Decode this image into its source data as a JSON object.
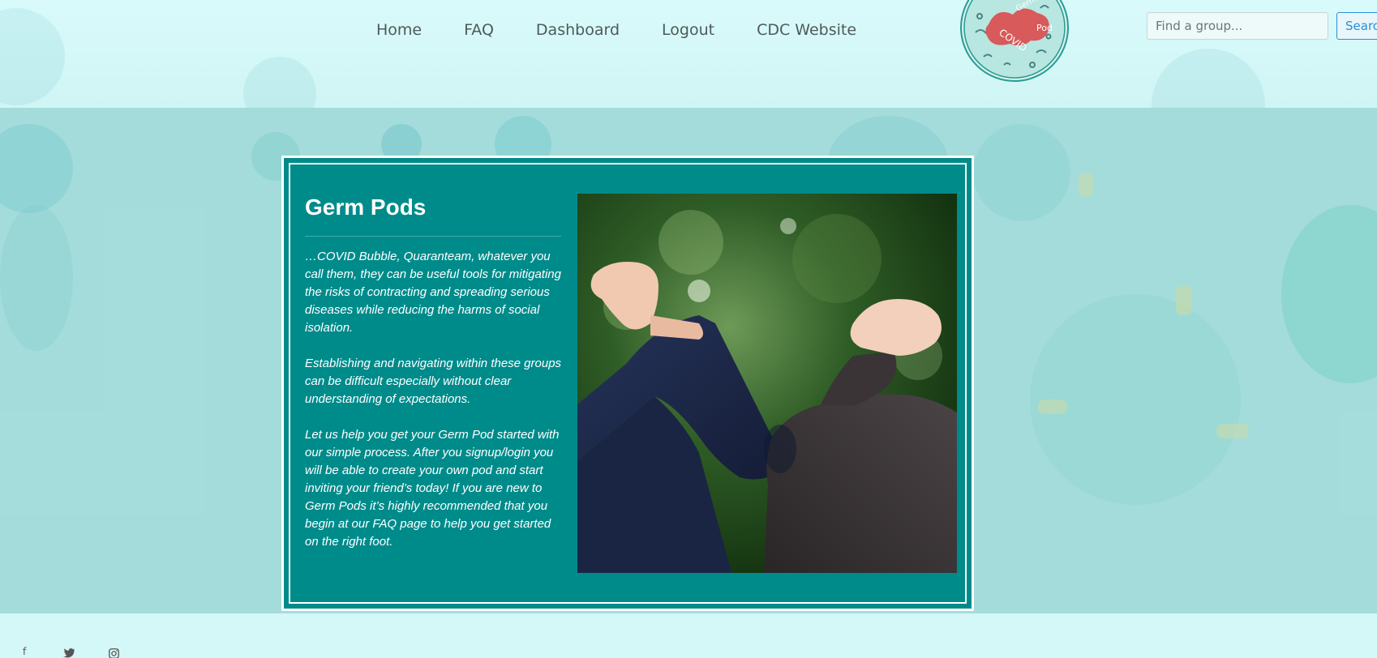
{
  "nav": {
    "home": "Home",
    "faq": "FAQ",
    "dashboard": "Dashboard",
    "logout": "Logout",
    "cdc": "CDC Website"
  },
  "logo": {
    "text_covid": "COVID",
    "text_germ": "Germ",
    "text_pod": "Pod"
  },
  "search": {
    "placeholder": "Find a group...",
    "button_label": "Search"
  },
  "card": {
    "title": "Germ Pods",
    "paragraphs": [
      "…COVID Bubble, Quaranteam, whatever you call them, they can be useful tools for mitigating the risks of contracting and spreading serious diseases while reducing the harms of social isolation.",
      "Establishing and navigating within these groups can be difficult especially without clear understanding of expectations.",
      "Let us help you get your Germ Pod started with our simple process. After you signup/login you will be able to create your own pod and start inviting your friend’s today! If you are new to Germ Pods it’s highly recommended that you begin at our FAQ page to help you get started on the right foot."
    ]
  },
  "footer": {
    "facebook_icon": "facebook-icon",
    "twitter_icon": "twitter-icon",
    "instagram_icon": "instagram-icon"
  },
  "colors": {
    "card_bg": "#008b8b",
    "header_bg": "#d9fafa",
    "search_button": "#2b8fd6"
  }
}
